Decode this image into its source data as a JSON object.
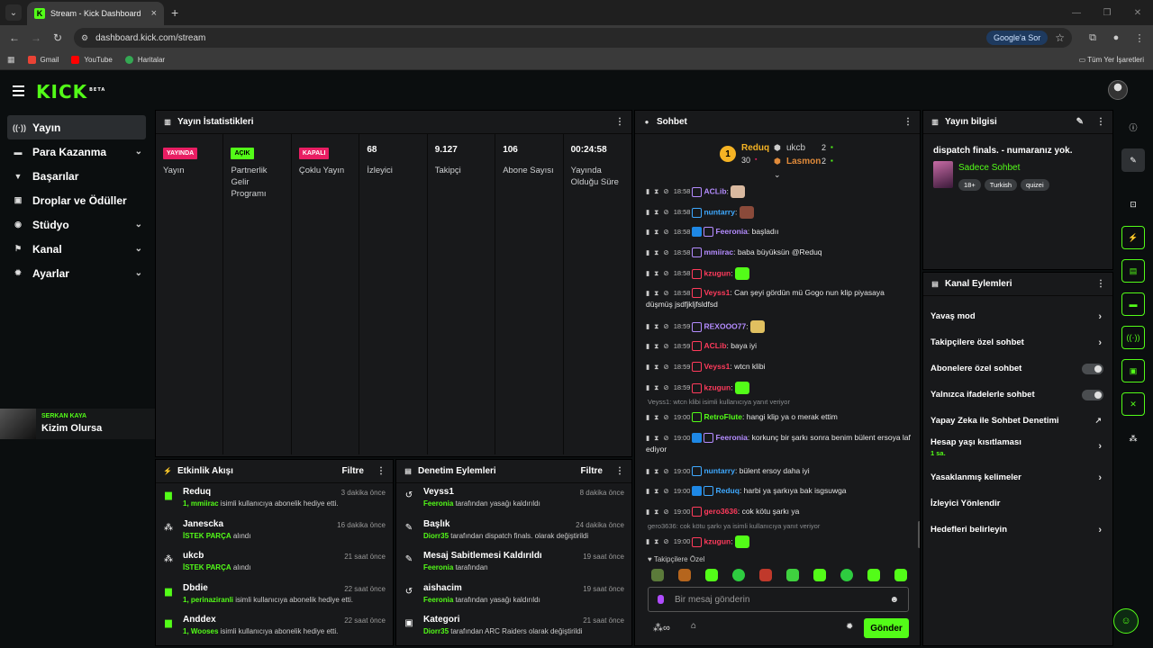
{
  "browser": {
    "tab_title": "Stream - Kick Dashboard",
    "url": "dashboard.kick.com/stream",
    "google_sor": "Google'a Sor",
    "bookmarks": [
      "Gmail",
      "YouTube",
      "Haritalar"
    ],
    "all_bookmarks": "Tüm Yer İşaretleri"
  },
  "app": {
    "logo": "KICK",
    "logo_badge": "BETA"
  },
  "sidebar": {
    "items": [
      {
        "label": "Yayın",
        "icon": "broadcast-icon"
      },
      {
        "label": "Para Kazanma",
        "icon": "money-icon"
      },
      {
        "label": "Başarılar",
        "icon": "trophy-icon"
      },
      {
        "label": "Droplar ve Ödüller",
        "icon": "gift-icon"
      },
      {
        "label": "Stüdyo",
        "icon": "studio-icon"
      },
      {
        "label": "Kanal",
        "icon": "channel-icon"
      },
      {
        "label": "Ayarlar",
        "icon": "gear-icon"
      }
    ]
  },
  "overlay": {
    "subtitle": "SERKAN KAYA",
    "title": "Kizim Olursa"
  },
  "stats_panel": {
    "title": "Yayın İstatistikleri",
    "items": [
      {
        "badge": "YAYINDA",
        "label": "Yayın"
      },
      {
        "badge": "AÇIK",
        "label": "Partnerlik Gelir Programı"
      },
      {
        "badge": "KAPALI",
        "label": "Çoklu Yayın"
      },
      {
        "value": "68",
        "label": "İzleyici"
      },
      {
        "value": "9.127",
        "label": "Takipçi"
      },
      {
        "value": "106",
        "label": "Abone Sayısı"
      },
      {
        "value": "00:24:58",
        "label": "Yayında Olduğu Süre"
      }
    ]
  },
  "activity_panel": {
    "title": "Etkinlik Akışı",
    "filter": "Filtre",
    "rows": [
      {
        "name": "Reduq",
        "time": "3 dakika önce",
        "desc_hl": "1, mmiirac",
        "desc": " isimli kullanıcıya abonelik hediye etti."
      },
      {
        "name": "Janescka",
        "time": "16 dakika önce",
        "desc_hl": "İSTEK PARÇA",
        "desc": " alındı"
      },
      {
        "name": "ukcb",
        "time": "21 saat önce",
        "desc_hl": "İSTEK PARÇA",
        "desc": " alındı"
      },
      {
        "name": "Dbdie",
        "time": "22 saat önce",
        "desc_hl": "1, perinaziranli",
        "desc": " isimli kullanıcıya abonelik hediye etti."
      },
      {
        "name": "Anddex",
        "time": "22 saat önce",
        "desc_hl": "1, Wooses",
        "desc": " isimli kullanıcıya abonelik hediye etti."
      }
    ]
  },
  "moderation_panel": {
    "title": "Denetim Eylemleri",
    "filter": "Filtre",
    "rows": [
      {
        "name": "Veyss1",
        "time": "8 dakika önce",
        "desc_hl": "Feeronia",
        "desc": " tarafından yasağı kaldırıldı"
      },
      {
        "name": "Başlık",
        "time": "24 dakika önce",
        "desc_hl": "Diorr35",
        "desc": " tarafından dispatch finals. olarak değiştirildi"
      },
      {
        "name": "Mesaj Sabitlemesi Kaldırıldı",
        "time": "19 saat önce",
        "desc_hl": "Feeronia",
        "desc": " tarafından"
      },
      {
        "name": "aishacim",
        "time": "19 saat önce",
        "desc_hl": "Feeronia",
        "desc": " tarafından yasağı kaldırıldı"
      },
      {
        "name": "Kategori",
        "time": "21 saat önce",
        "desc_hl": "Diorr35",
        "desc": " tarafından ARC Raiders olarak değiştirildi"
      }
    ]
  },
  "chat_panel": {
    "title": "Sohbet",
    "top_gifter": {
      "rank": "1",
      "name": "Reduq",
      "count": "30"
    },
    "others": [
      {
        "name": "ukcb",
        "count": "2"
      },
      {
        "name": "Lasmon",
        "count": "2"
      }
    ],
    "messages": [
      {
        "time": "18:58",
        "user": "ACLib",
        "color": "#b48cff",
        "text": ""
      },
      {
        "time": "18:58",
        "user": "nuntarry",
        "color": "#3fa9ff",
        "text": ""
      },
      {
        "time": "18:58",
        "user": "Feeronia",
        "color": "#b48cff",
        "text": " başladıı"
      },
      {
        "time": "18:58",
        "user": "mmiirac",
        "color": "#b48cff",
        "text": " baba büyüksün @Reduq"
      },
      {
        "time": "18:58",
        "user": "kzugun",
        "color": "#ff3b5c",
        "text": ""
      },
      {
        "time": "18:58",
        "user": "Veyss1",
        "color": "#ff3b5c",
        "text": " Can şeyi gördün mü Gogo nun klip piyasaya düşmüş jsdfjkljfsldfsd"
      },
      {
        "time": "18:59",
        "user": "REXOOO77",
        "color": "#b48cff",
        "text": ""
      },
      {
        "time": "18:59",
        "user": "ACLib",
        "color": "#ff3b5c",
        "text": " baya iyi"
      },
      {
        "time": "18:59",
        "user": "Veyss1",
        "color": "#ff3b5c",
        "text": " wtcn klibi"
      },
      {
        "time": "18:59",
        "user": "kzugun",
        "color": "#ff3b5c",
        "text": ""
      },
      {
        "time": "19:00",
        "user": "RetroFlute",
        "color": "#53fc18",
        "text": " hangi klip ya o merak ettim"
      },
      {
        "time": "19:00",
        "user": "Feeronia",
        "color": "#b48cff",
        "text": " korkunç bir şarkı sonra benim bülent ersoya laf ediyor"
      },
      {
        "time": "19:00",
        "user": "nuntarry",
        "color": "#3fa9ff",
        "text": " bülent ersoy daha iyi"
      },
      {
        "time": "19:00",
        "user": "Reduq",
        "color": "#3fa9ff",
        "text": " harbi ya şarkıya bak isgsuwga"
      },
      {
        "time": "19:00",
        "user": "gero3636",
        "color": "#ff3b5c",
        "text": " cok kötu şarkı ya"
      },
      {
        "time": "19:00",
        "user": "kzugun",
        "color": "#ff3b5c",
        "text": ""
      }
    ],
    "reply1": "Veyss1: wtcn klibi isimli kullanıcıya yanıt veriyor",
    "reply2": "gero3636: cok kötu şarkı ya isimli kullanıcıya yanıt veriyor",
    "followers_only": "Takipçilere Özel",
    "input_placeholder": "Bir mesaj gönderin",
    "send": "Gönder"
  },
  "info_panel": {
    "title": "Yayın bilgisi",
    "stream_title": "dispatch finals. - numaranız yok.",
    "category": "Sadece Sohbet",
    "tags": [
      "18+",
      "Turkish",
      "quizei"
    ]
  },
  "channel_actions": {
    "title": "Kanal Eylemleri",
    "rows": [
      {
        "label": "Yavaş mod",
        "kind": "chev"
      },
      {
        "label": "Takipçilere özel sohbet",
        "kind": "chev"
      },
      {
        "label": "Abonelere özel sohbet",
        "kind": "toggle"
      },
      {
        "label": "Yalnızca ifadelerle sohbet",
        "kind": "toggle"
      },
      {
        "label": "Yapay Zeka ile Sohbet Denetimi",
        "kind": "ext"
      },
      {
        "label": "Hesap yaşı kısıtlaması",
        "sub": "1 sa.",
        "kind": "chev"
      },
      {
        "label": "Yasaklanmış kelimeler",
        "kind": "chev"
      },
      {
        "label": "İzleyici Yönlendir",
        "kind": "none"
      },
      {
        "label": "Hedefleri belirleyin",
        "kind": "chev"
      }
    ]
  },
  "colors": {
    "accent": "#53fc18",
    "live": "#e91e63",
    "panel": "#18191b",
    "bg": "#0b0e0f"
  }
}
